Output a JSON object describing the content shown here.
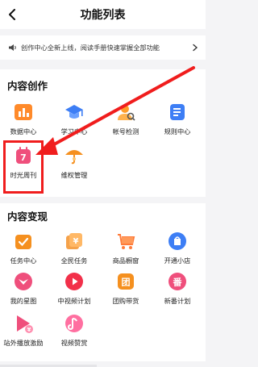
{
  "header": {
    "title": "功能列表"
  },
  "notice": {
    "text": "创作中心全新上线，阅读手册快速掌握全部功能"
  },
  "creation": {
    "title": "内容创作",
    "items": [
      {
        "label": "数据中心",
        "icon": "data-center-icon"
      },
      {
        "label": "学习中心",
        "icon": "learning-center-icon"
      },
      {
        "label": "帐号检测",
        "icon": "account-check-icon"
      },
      {
        "label": "规则中心",
        "icon": "rules-center-icon"
      },
      {
        "label": "时光周刊",
        "icon": "time-weekly-icon",
        "badge": "7"
      },
      {
        "label": "维权管理",
        "icon": "rights-management-icon"
      }
    ]
  },
  "monetize": {
    "title": "内容变现",
    "items": [
      {
        "label": "任务中心",
        "icon": "task-center-icon"
      },
      {
        "label": "全民任务",
        "icon": "all-people-task-icon",
        "badge": "¥"
      },
      {
        "label": "商品橱窗",
        "icon": "product-window-icon"
      },
      {
        "label": "开通小店",
        "icon": "open-shop-icon"
      },
      {
        "label": "我的星图",
        "icon": "star-map-icon"
      },
      {
        "label": "中视频计划",
        "icon": "mid-video-plan-icon"
      },
      {
        "label": "团购带货",
        "icon": "group-buy-icon",
        "badge": "团"
      },
      {
        "label": "新番计划",
        "icon": "new-series-plan-icon",
        "badge": "番"
      },
      {
        "label": "站外播放激励",
        "icon": "offsite-play-reward-icon"
      },
      {
        "label": "视频赞赏",
        "icon": "video-tip-icon"
      }
    ]
  },
  "colors": {
    "highlight": "#f01d1d",
    "accent_orange": "#f5901f",
    "accent_blue": "#3d7ef5",
    "accent_pink": "#ef4f7c"
  }
}
